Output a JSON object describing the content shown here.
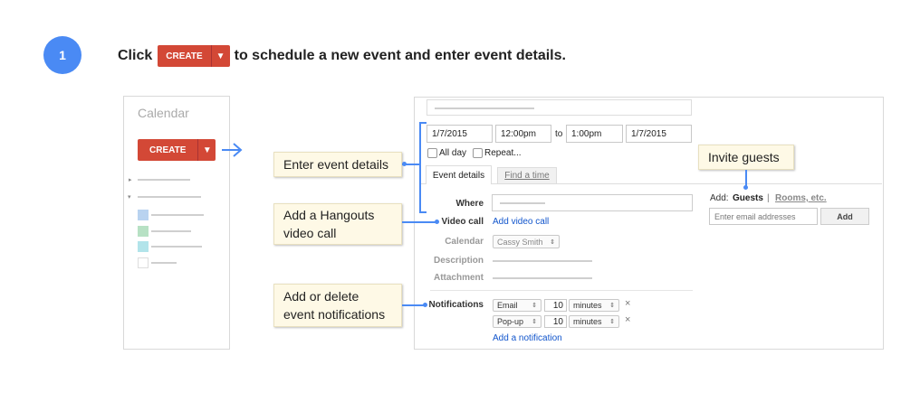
{
  "step": {
    "number": "1"
  },
  "instruction": {
    "prefix": "Click",
    "button_label": "CREATE",
    "button_arrow": "▼",
    "suffix": "to schedule a new event and enter event details."
  },
  "sidebar": {
    "title": "Calendar",
    "create_label": "CREATE",
    "create_arrow": "▼",
    "swatch_colors": [
      "#b9d3f0",
      "#b7e1c4",
      "#b2e4ea",
      "#ffffff"
    ]
  },
  "event": {
    "start_date": "1/7/2015",
    "start_time": "12:00pm",
    "to_label": "to",
    "end_time": "1:00pm",
    "end_date": "1/7/2015",
    "all_day_label": "All day",
    "repeat_label": "Repeat...",
    "tabs": [
      {
        "label": "Event details"
      },
      {
        "label": "Find a time"
      }
    ],
    "where_label": "Where",
    "video_call_label": "Video call",
    "add_video_call_link": "Add video call",
    "calendar_label": "Calendar",
    "calendar_value": "Cassy Smith",
    "description_label": "Description",
    "attachment_label": "Attachment",
    "notifications_label": "Notifications",
    "notifications": [
      {
        "type": "Email",
        "amount": "10",
        "unit": "minutes",
        "remove": "×"
      },
      {
        "type": "Pop-up",
        "amount": "10",
        "unit": "minutes",
        "remove": "×"
      }
    ],
    "add_notification_link": "Add a notification"
  },
  "guests": {
    "add_label": "Add:",
    "guests_tab": "Guests",
    "separator": "|",
    "rooms_tab": "Rooms, etc.",
    "input_placeholder": "Enter email addresses",
    "add_button": "Add"
  },
  "callouts": {
    "event_details": "Enter event details",
    "hangouts": "Add a Hangouts video call",
    "notifications": "Add or delete event notifications",
    "invite_guests": "Invite guests"
  },
  "colors": {
    "accent_blue": "#4a8af4",
    "create_red": "#d34836",
    "callout_bg": "#fef9e6"
  }
}
